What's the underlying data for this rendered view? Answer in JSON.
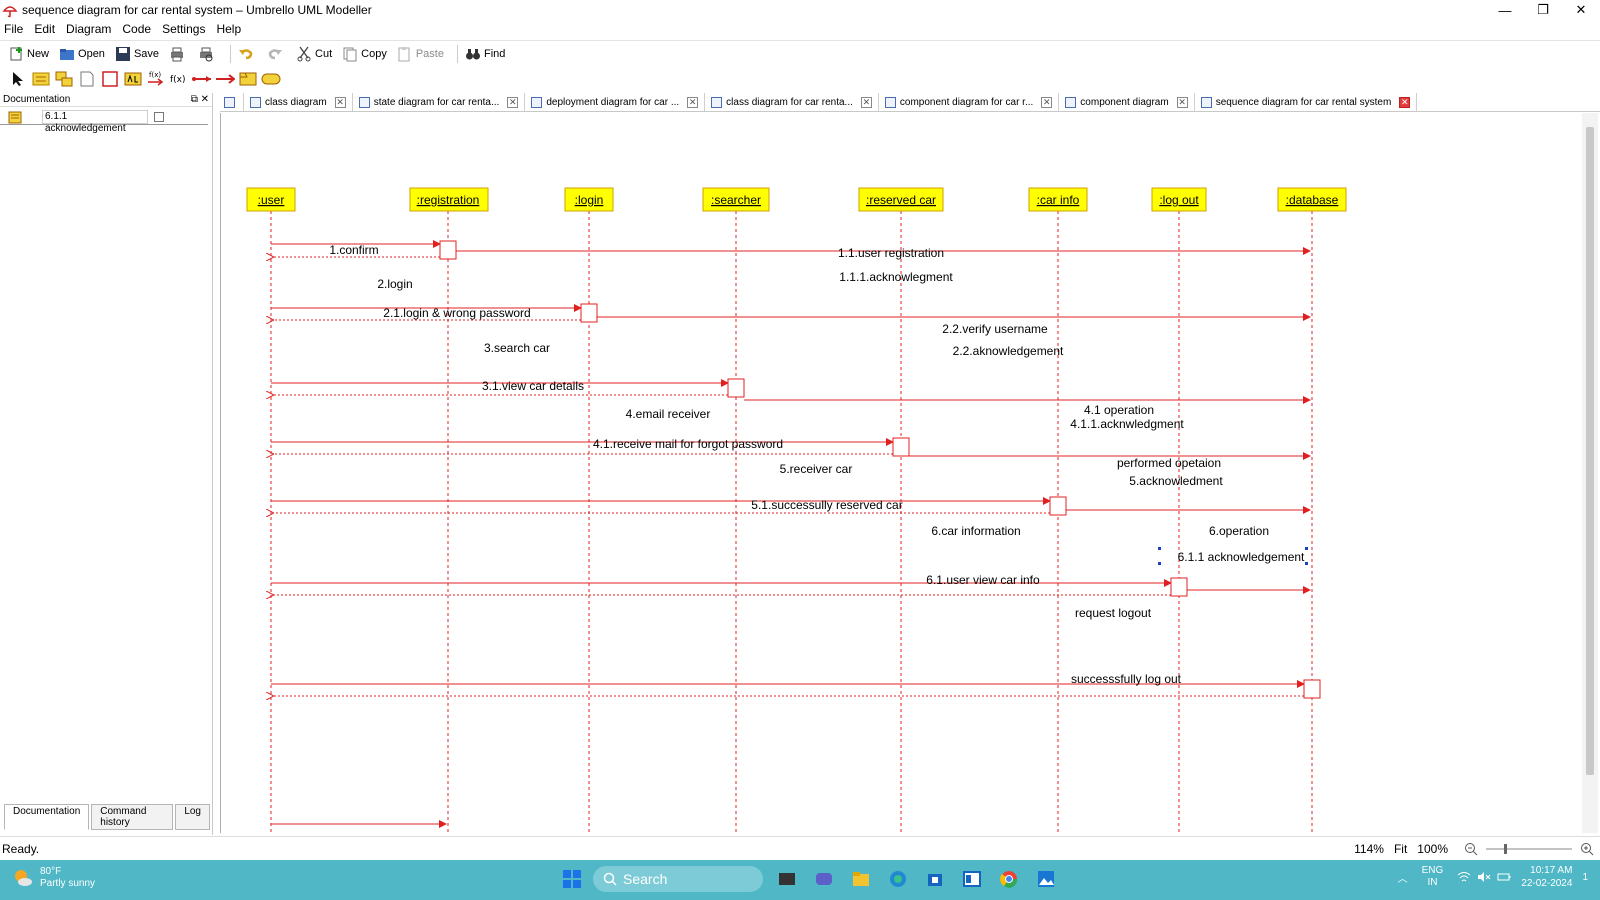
{
  "window": {
    "title": "sequence diagram for car rental system – Umbrello UML Modeller",
    "minimize": "—",
    "restore": "❐",
    "close": "✕"
  },
  "menu": [
    "File",
    "Edit",
    "Diagram",
    "Code",
    "Settings",
    "Help"
  ],
  "toolbar": {
    "new": "New",
    "open": "Open",
    "save": "Save",
    "cut": "Cut",
    "copy": "Copy",
    "paste": "Paste",
    "find": "Find"
  },
  "dock": {
    "title": "Documentation",
    "item_name": "6.1.1 acknowledgement",
    "tabs": [
      "Documentation",
      "Command history",
      "Log"
    ]
  },
  "tabs": [
    {
      "label": "class diagram",
      "active": false
    },
    {
      "label": "state diagram for car renta...",
      "active": false
    },
    {
      "label": "deployment diagram for car ...",
      "active": false
    },
    {
      "label": "class diagram for car renta...",
      "active": false
    },
    {
      "label": "component diagram for car r...",
      "active": false
    },
    {
      "label": "component diagram",
      "active": false
    },
    {
      "label": "sequence diagram for car rental system",
      "active": true
    }
  ],
  "diagram": {
    "lifelines": [
      ":user",
      ":registration",
      ":login",
      ":searcher",
      ":reserved car",
      ":car info",
      ":log out",
      ":database"
    ],
    "messages": [
      "1.confirm",
      "1.1.user registration",
      "1.1.1.acknowlegment",
      "2.login",
      "2.1.login & wrong password",
      "2.2.verify username",
      "2.2.aknowledgement",
      "3.search car",
      "3.1.view car details",
      "4.email receiver",
      "4.1 operation",
      "4.1.1.acknwledgment",
      "4.1.receive mail for forgot password",
      "5.receiver car",
      "performed opetaion",
      "5.acknowledment",
      "5.1.successully reserved car",
      "6.car information",
      "6.operation",
      "6.1.1 acknowledgement",
      "6.1.user view car info",
      "request logout",
      "successsfully log out"
    ],
    "line_color": "#e02020",
    "head_color": "#ffff00"
  },
  "status": {
    "ready": "Ready.",
    "zoom": "114%",
    "fit": "Fit",
    "full": "100%"
  },
  "taskbar": {
    "temp": "80°F",
    "condition": "Partly sunny",
    "search": "Search",
    "lang1": "ENG",
    "lang2": "IN",
    "time": "10:17 AM",
    "date": "22-02-2024",
    "notif": "1"
  }
}
